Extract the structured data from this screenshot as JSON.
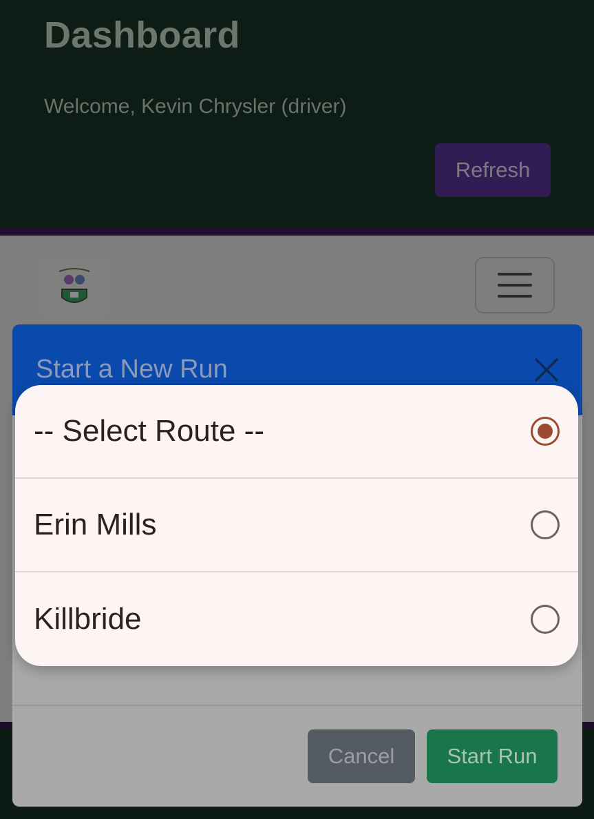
{
  "dashboard": {
    "title": "Dashboard",
    "welcome": "Welcome, Kevin Chrysler (driver)",
    "refresh_label": "Refresh"
  },
  "navbar": {
    "logo": "school-crest-logo",
    "menu_icon": "hamburger-menu-icon"
  },
  "modal": {
    "title": "Start a New Run",
    "close_icon": "close-icon",
    "cancel_label": "Cancel",
    "start_label": "Start Run"
  },
  "route_picker": {
    "selected_index": 0,
    "options": [
      {
        "label": "-- Select Route --",
        "checked": true
      },
      {
        "label": "Erin Mills",
        "checked": false
      },
      {
        "label": "Killbride",
        "checked": false
      }
    ]
  },
  "colors": {
    "modal_header": "#0b4aad",
    "start_button": "#19764a",
    "cancel_button": "#545b62",
    "refresh_button": "#311c54",
    "radio_accent": "#9c4b32"
  }
}
